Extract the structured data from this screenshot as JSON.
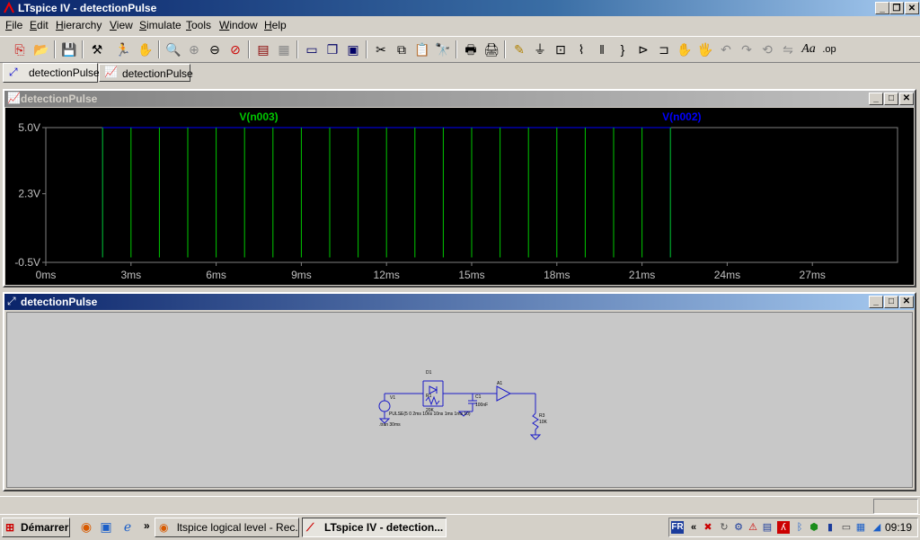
{
  "app": {
    "title": "LTspice IV - detectionPulse"
  },
  "menu": [
    "File",
    "Edit",
    "Hierarchy",
    "View",
    "Simulate",
    "Tools",
    "Window",
    "Help"
  ],
  "doc_tabs": [
    "detectionPulse",
    "detectionPulse"
  ],
  "waveform_window": {
    "title": "detectionPulse",
    "trace_labels": [
      "V(n003)",
      "V(n002)"
    ]
  },
  "schematic_window": {
    "title": "detectionPulse"
  },
  "schematic": {
    "v1_label": "V1",
    "v1_value": "PULSE(5 0 2ms 10ns 10ns 1ms 1ms 10)",
    "tran": ".tran 30ms",
    "d1": "D1",
    "r1": "R1",
    "r1_val": "20K",
    "c1": "C1",
    "c1_val": "100nF",
    "a1": "A1",
    "r3": "R3",
    "r3_val": "10K"
  },
  "chart_data": {
    "type": "line",
    "xlabel": "",
    "ylabel": "",
    "xlim": [
      0,
      30
    ],
    "ylim": [
      -0.5,
      5.0
    ],
    "x_ticks": [
      "0ms",
      "3ms",
      "6ms",
      "9ms",
      "12ms",
      "15ms",
      "18ms",
      "21ms",
      "24ms",
      "27ms"
    ],
    "y_ticks": [
      "5.0V",
      "2.3V",
      "-0.5V"
    ],
    "grid": false,
    "series": [
      {
        "name": "V(n003)",
        "color": "#00c800",
        "pulse_edges_ms": [
          2,
          3,
          4,
          5,
          6,
          7,
          8,
          9,
          10,
          11,
          12,
          13,
          14,
          15,
          16,
          17,
          18,
          19,
          20,
          21,
          22
        ],
        "high": 5.0,
        "low": -0.3
      },
      {
        "name": "V(n002)",
        "color": "#0000ff",
        "x_ms": [
          2,
          2,
          22,
          22
        ],
        "y": [
          -0.3,
          5.0,
          5.0,
          -0.3
        ]
      }
    ]
  },
  "taskbar": {
    "start": "Démarrer",
    "tasks": [
      "ltspice logical level - Rec...",
      "LTspice IV - detection..."
    ],
    "lang": "FR",
    "clock": "09:19"
  }
}
